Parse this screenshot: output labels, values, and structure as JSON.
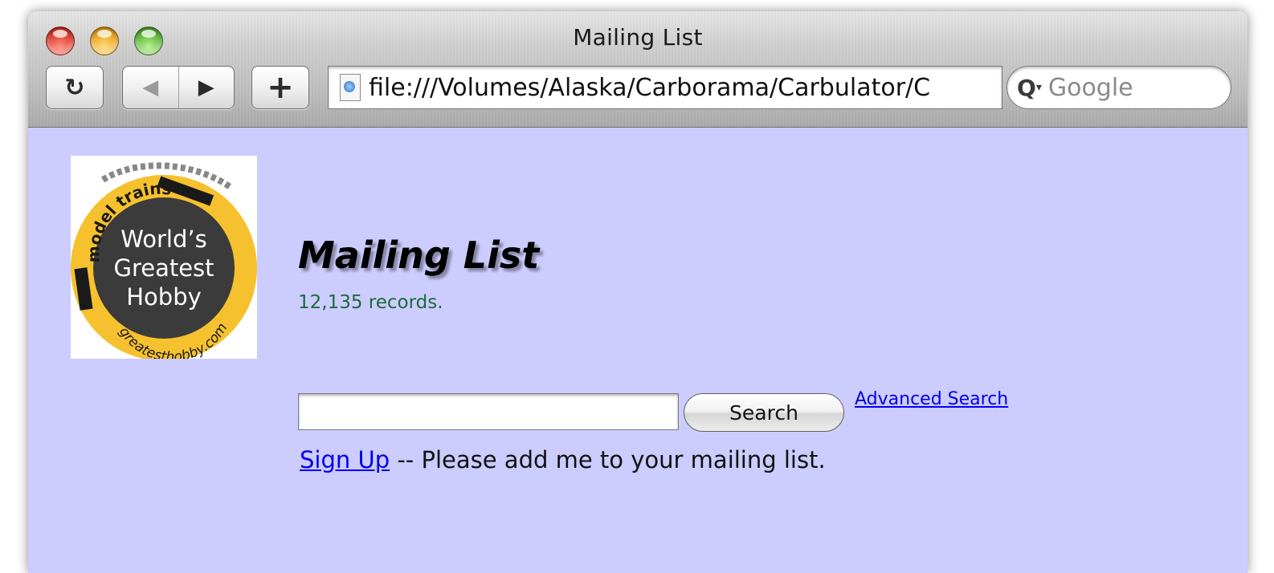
{
  "window": {
    "title": "Mailing List"
  },
  "toolbar": {
    "reload_glyph": "↻",
    "back_glyph": "◀",
    "forward_glyph": "▶",
    "add_glyph": "+",
    "url": "file:///Volumes/Alaska/Carborama/Carbulator/C",
    "url_stepper_glyph": "⌃",
    "search_glyph": "Q",
    "search_menu_glyph": "▾",
    "search_placeholder": "Google"
  },
  "logo": {
    "ring_top": "model trains",
    "line1": "World’s",
    "line2": "Greatest",
    "line3": "Hobby",
    "ring_bottom": "greatesthobby.com",
    "colors": {
      "ring": "#f6c12e",
      "disc": "#3b3b3b",
      "text": "#ffffff"
    }
  },
  "page": {
    "title": "Mailing List",
    "record_count": "12,135 records.",
    "search_button": "Search",
    "advanced_search": "Advanced Search",
    "signup_link": "Sign Up",
    "signup_text": " -- Please add me to your mailing list.",
    "background": "#ccccff"
  }
}
